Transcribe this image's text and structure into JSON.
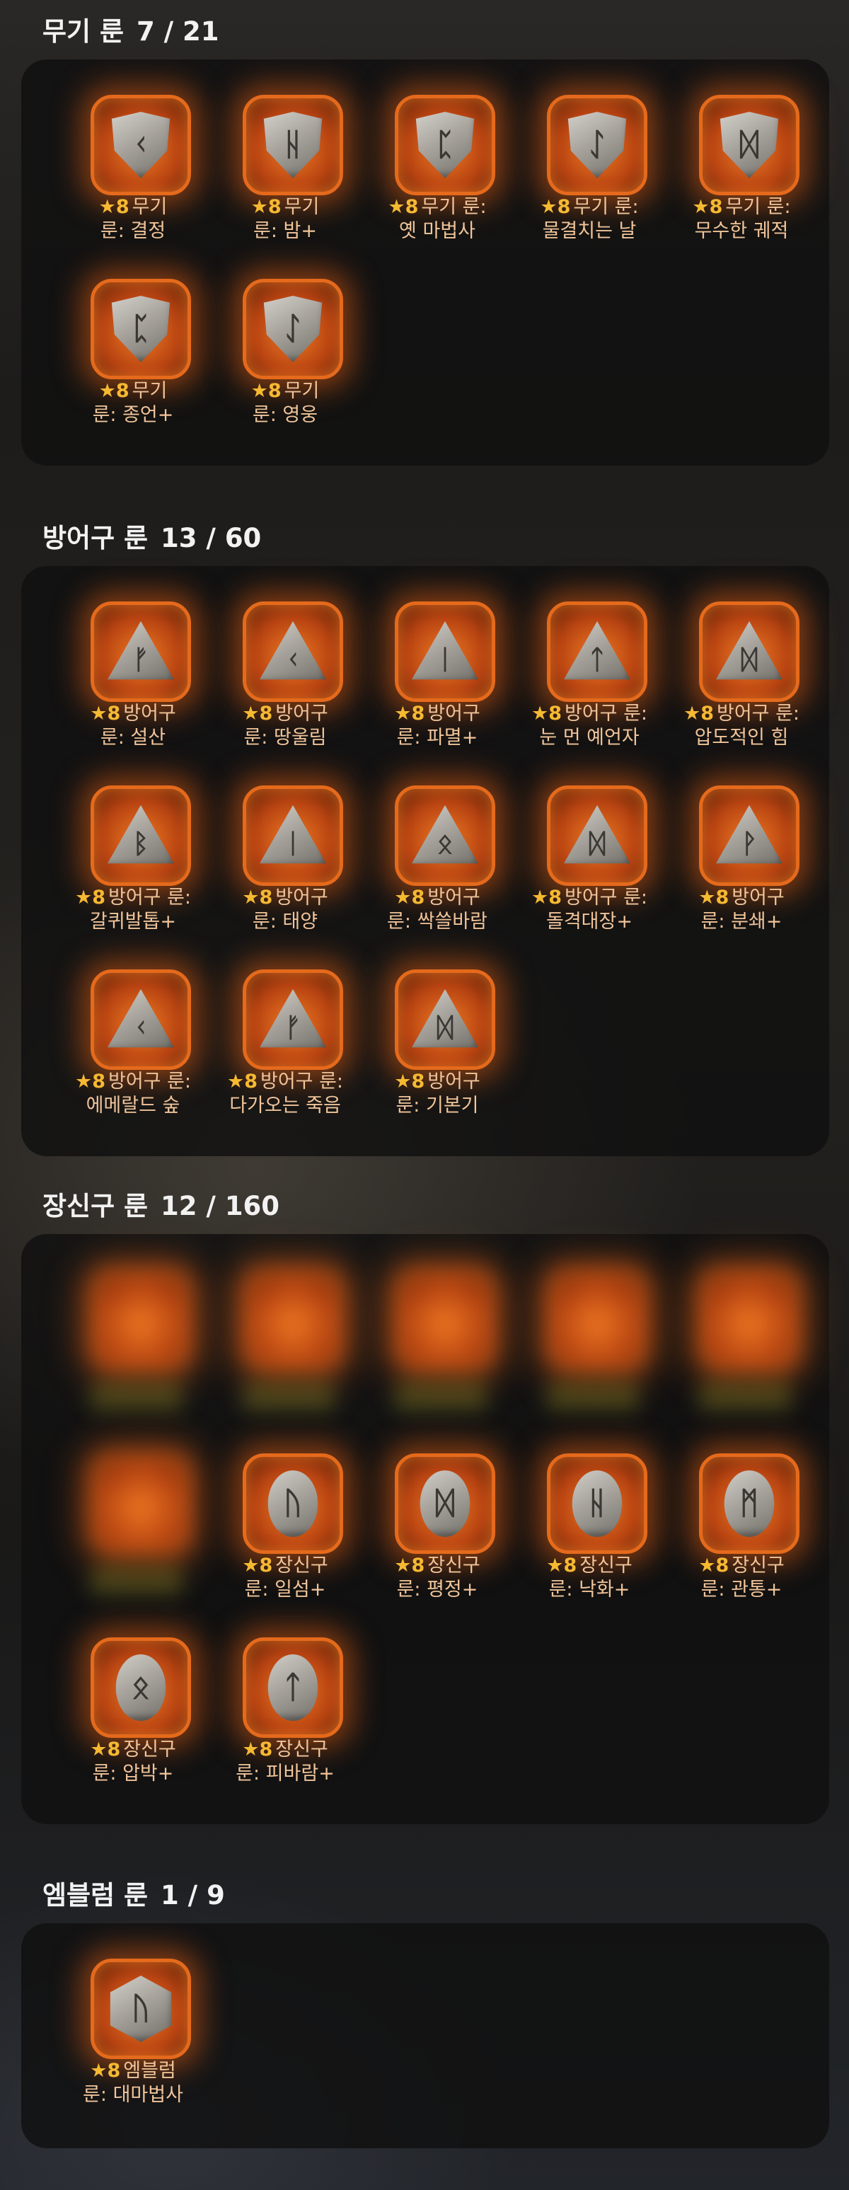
{
  "sections": [
    {
      "title": "무기 룬",
      "count": "7 / 21",
      "runes": [
        {
          "tier": "8",
          "shape": "shield",
          "glyph": "ᚲ",
          "line1": "무기",
          "line2": "룬: 결정"
        },
        {
          "tier": "8",
          "shape": "shield",
          "glyph": "ᚺ",
          "line1": "무기",
          "line2": "룬: 밤+"
        },
        {
          "tier": "8",
          "shape": "shield",
          "glyph": "ᛈ",
          "line1": "무기 룬:",
          "line2": "옛 마법사"
        },
        {
          "tier": "8",
          "shape": "shield",
          "glyph": "ᛇ",
          "line1": "무기 룬:",
          "line2": "물결치는 날"
        },
        {
          "tier": "8",
          "shape": "shield",
          "glyph": "ᛞ",
          "line1": "무기 룬:",
          "line2": "무수한 궤적"
        },
        {
          "tier": "8",
          "shape": "shield",
          "glyph": "ᛈ",
          "line1": "무기",
          "line2": "룬: 종언+"
        },
        {
          "tier": "8",
          "shape": "shield",
          "glyph": "ᛇ",
          "line1": "무기",
          "line2": "룬: 영웅"
        }
      ]
    },
    {
      "title": "방어구 룬",
      "count": "13 / 60",
      "runes": [
        {
          "tier": "8",
          "shape": "tri",
          "glyph": "ᚠ",
          "line1": "방어구",
          "line2": "룬: 설산"
        },
        {
          "tier": "8",
          "shape": "tri",
          "glyph": "ᚲ",
          "line1": "방어구",
          "line2": "룬: 땅울림"
        },
        {
          "tier": "8",
          "shape": "tri",
          "glyph": "ᛁ",
          "line1": "방어구",
          "line2": "룬: 파멸+"
        },
        {
          "tier": "8",
          "shape": "tri",
          "glyph": "ᛏ",
          "line1": "방어구 룬:",
          "line2": "눈 먼 예언자"
        },
        {
          "tier": "8",
          "shape": "tri",
          "glyph": "ᛞ",
          "line1": "방어구 룬:",
          "line2": "압도적인 힘"
        },
        {
          "tier": "8",
          "shape": "tri",
          "glyph": "ᛒ",
          "line1": "방어구 룬:",
          "line2": "갈퀴발톱+"
        },
        {
          "tier": "8",
          "shape": "tri",
          "glyph": "ᛁ",
          "line1": "방어구",
          "line2": "룬: 태양"
        },
        {
          "tier": "8",
          "shape": "tri",
          "glyph": "ᛟ",
          "line1": "방어구",
          "line2": "룬: 싹쓸바람"
        },
        {
          "tier": "8",
          "shape": "tri",
          "glyph": "ᛞ",
          "line1": "방어구 룬:",
          "line2": "돌격대장+"
        },
        {
          "tier": "8",
          "shape": "tri",
          "glyph": "ᚹ",
          "line1": "방어구",
          "line2": "룬: 분쇄+"
        },
        {
          "tier": "8",
          "shape": "tri",
          "glyph": "ᚲ",
          "line1": "방어구 룬:",
          "line2": "에메랄드 숲"
        },
        {
          "tier": "8",
          "shape": "tri",
          "glyph": "ᚠ",
          "line1": "방어구 룬:",
          "line2": "다가오는 죽음"
        },
        {
          "tier": "8",
          "shape": "tri",
          "glyph": "ᛞ",
          "line1": "방어구",
          "line2": "룬: 기본기"
        }
      ]
    },
    {
      "title": "장신구 룬",
      "count": "12 / 160",
      "blurred_count": 6,
      "runes": [
        {
          "tier": "8",
          "shape": "oval",
          "glyph": "ᚢ",
          "line1": "장신구",
          "line2": "룬: 일섬+"
        },
        {
          "tier": "8",
          "shape": "oval",
          "glyph": "ᛞ",
          "line1": "장신구",
          "line2": "룬: 평정+"
        },
        {
          "tier": "8",
          "shape": "oval",
          "glyph": "ᚺ",
          "line1": "장신구",
          "line2": "룬: 낙화+"
        },
        {
          "tier": "8",
          "shape": "oval",
          "glyph": "ᛗ",
          "line1": "장신구",
          "line2": "룬: 관통+"
        },
        {
          "tier": "8",
          "shape": "oval",
          "glyph": "ᛟ",
          "line1": "장신구",
          "line2": "룬: 압박+"
        },
        {
          "tier": "8",
          "shape": "oval",
          "glyph": "ᛏ",
          "line1": "장신구",
          "line2": "룬: 피바람+"
        }
      ]
    },
    {
      "title": "엠블럼 룬",
      "count": "1 / 9",
      "runes": [
        {
          "tier": "8",
          "shape": "hex",
          "glyph": "ᚢ",
          "line1": "엠블럼",
          "line2": "룬: 대마법사"
        }
      ]
    }
  ],
  "colors": {
    "accent_orange": "#e56a1c",
    "star_gold": "#f5b932",
    "caption_text": "#f0c49a",
    "title_text": "#f2f2f2"
  },
  "icons": {
    "star": "★"
  }
}
